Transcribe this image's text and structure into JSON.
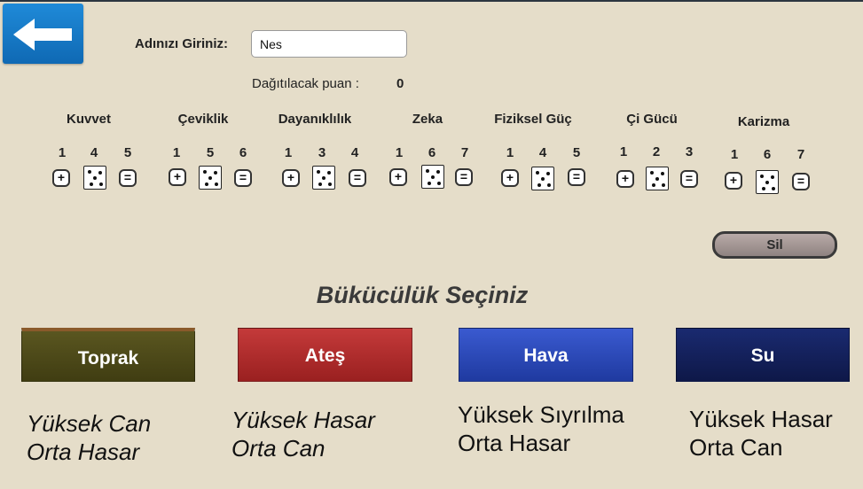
{
  "form": {
    "name_label": "Adınızı Giriniz:",
    "name_value": "Nes",
    "points_label": "Dağıtılacak puan :",
    "points_value": "0"
  },
  "stats": [
    {
      "name": "Kuvvet",
      "min": "1",
      "value": "4",
      "max": "5"
    },
    {
      "name": "Çeviklik",
      "min": "1",
      "value": "5",
      "max": "6"
    },
    {
      "name": "Dayanıklılık",
      "min": "1",
      "value": "3",
      "max": "4"
    },
    {
      "name": "Zeka",
      "min": "1",
      "value": "6",
      "max": "7"
    },
    {
      "name": "Fiziksel Güç",
      "min": "1",
      "value": "4",
      "max": "5"
    },
    {
      "name": "Çi Gücü",
      "min": "1",
      "value": "2",
      "max": "3"
    },
    {
      "name": "Karizma",
      "min": "1",
      "value": "6",
      "max": "7"
    }
  ],
  "buttons": {
    "plus": "+",
    "minus": "=",
    "delete": "Sil"
  },
  "bending": {
    "title": "Bükücülük Seçiniz",
    "elements": [
      {
        "label": "Toprak",
        "line1": "Yüksek Can",
        "line2": "Orta Hasar",
        "color": "#4d4a18"
      },
      {
        "label": "Ateş",
        "line1": "Yüksek Hasar",
        "line2": "Orta Can",
        "color": "#b02a2a"
      },
      {
        "label": "Hava",
        "line1": "Yüksek Sıyrılma",
        "line2": "Orta Hasar",
        "color": "#2a48b0"
      },
      {
        "label": "Su",
        "line1": "Yüksek Hasar",
        "line2": "Orta Can",
        "color": "#132058"
      }
    ]
  },
  "icons": {
    "back": "arrow-left-icon",
    "die": "die-icon"
  }
}
